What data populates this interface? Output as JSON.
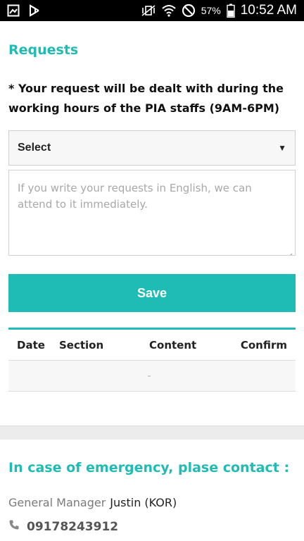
{
  "status_bar": {
    "battery": "57%",
    "time": "10:52 AM",
    "icons": [
      "image-icon",
      "play-store-icon",
      "vibrate-icon",
      "wifi-icon",
      "do-not-disturb-icon",
      "battery-icon"
    ]
  },
  "requests": {
    "title": "Requests",
    "notice": "* Your request will be dealt with during the working hours of the PIA staffs (9AM-6PM)",
    "select_value": "Select",
    "textarea_placeholder": "If you write your requests in English, we can attend to it immediately.",
    "save_label": "Save",
    "table": {
      "headers": [
        "Date",
        "Section",
        "Content",
        "Confirm"
      ],
      "empty_text": "-"
    }
  },
  "emergency": {
    "title": "In case of emergency, plase contact :",
    "manager_label": "General Manager",
    "manager_name": "Justin (KOR)",
    "phone": "09178243912"
  },
  "colors": {
    "accent": "#1fbcb5",
    "status_bar": "#000000"
  }
}
